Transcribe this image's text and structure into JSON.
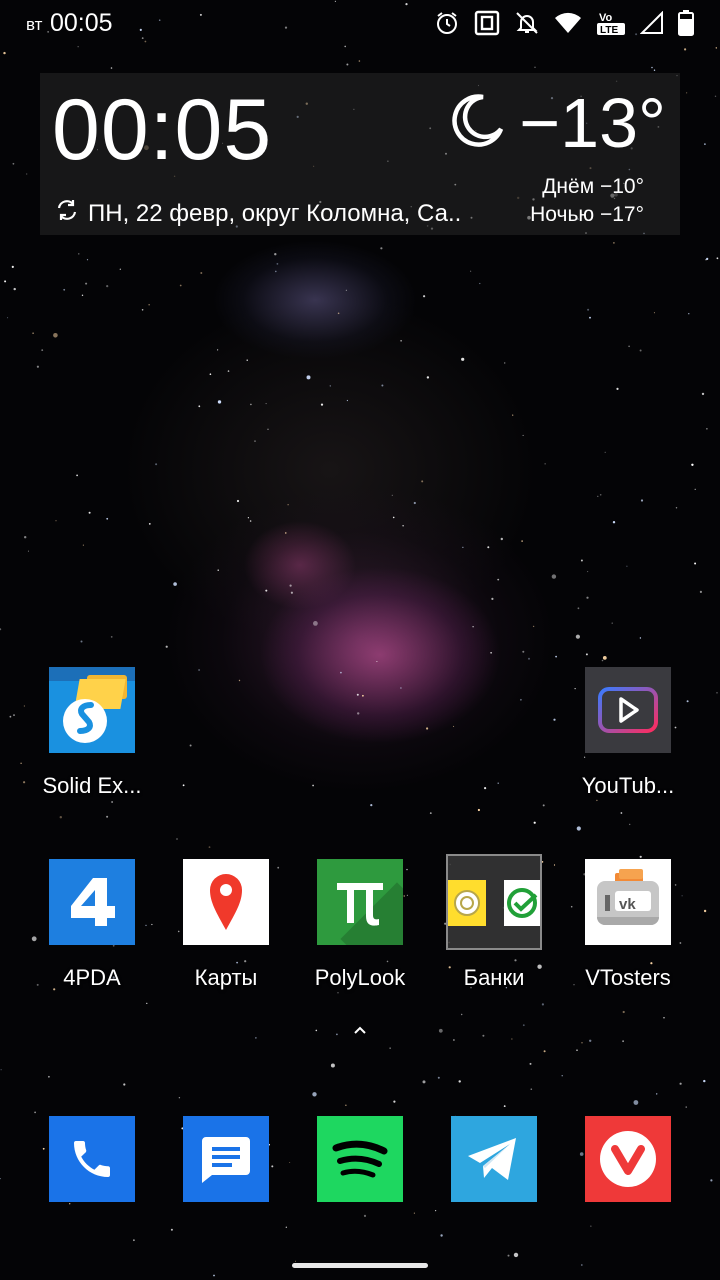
{
  "status_bar": {
    "day": "вт",
    "time": "00:05",
    "icons": [
      "alarm-icon",
      "nfc-icon",
      "notifications-off-icon",
      "wifi-icon",
      "volte-icon",
      "signal-icon",
      "battery-icon"
    ],
    "volte_top": "Vo",
    "volte_bottom": "LTE"
  },
  "clock_widget": {
    "time": "00:05",
    "temperature": "−13°",
    "weather_icon": "moon-icon",
    "date_location": "ПН, 22 февр, округ Коломна, Са..",
    "day_temp": "Днём −10°",
    "night_temp": "Ночью −17°"
  },
  "apps_row1": [
    {
      "label": "Solid Ex...",
      "icon": "solid-explorer-icon",
      "color": "#1a91e0"
    },
    {
      "label": "YouTub...",
      "icon": "youtube-vanced-icon",
      "color": "#3a3a3f"
    }
  ],
  "apps_row2": [
    {
      "label": "4PDA",
      "icon": "4pda-icon",
      "color": "#1e7fe0"
    },
    {
      "label": "Карты",
      "icon": "maps-icon",
      "color": "#ffffff"
    },
    {
      "label": "PolyLook",
      "icon": "polylook-icon",
      "color": "#2e9a3e"
    },
    {
      "label": "Банки",
      "icon": "folder-icon",
      "color": "#333333"
    },
    {
      "label": "VTosters",
      "icon": "vtosters-icon",
      "color": "#ffffff"
    }
  ],
  "dock": [
    {
      "icon": "phone-icon",
      "color": "#1a73e8"
    },
    {
      "icon": "messages-icon",
      "color": "#1a73e8"
    },
    {
      "icon": "spotify-icon",
      "color": "#1ed760"
    },
    {
      "icon": "telegram-icon",
      "color": "#2ea6df"
    },
    {
      "icon": "vivaldi-icon",
      "color": "#ef3939"
    }
  ]
}
